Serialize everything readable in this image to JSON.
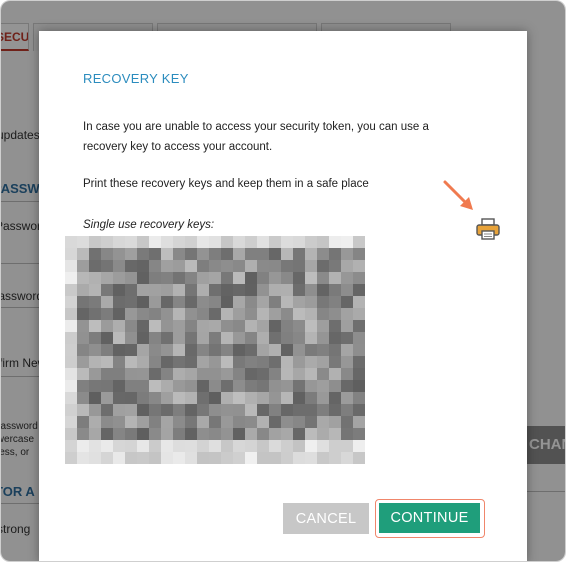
{
  "background": {
    "tabs": [
      "SECURITY"
    ],
    "lines": [
      "updates",
      "PASSWORD",
      "Password",
      "New Password",
      "Confirm New",
      "password",
      "lowercase",
      "less, or",
      "TOR A",
      "strong"
    ],
    "button_label": "CHANGE P"
  },
  "modal": {
    "title": "RECOVERY KEY",
    "description": "In case you are unable to access your security token, you can use a recovery key to access your account.",
    "print_message": "Print these recovery keys and keep them in a safe place",
    "keys_label": "Single use recovery keys:",
    "print_icon": "printer-icon",
    "cancel_label": "CANCEL",
    "continue_label": "CONTINUE"
  },
  "colors": {
    "accent_title": "#2b8cbe",
    "continue_green": "#1f9e7b",
    "cancel_gray": "#c7c7c7",
    "highlight_orange": "#f0866b",
    "printer_orange": "#e8a33a"
  }
}
